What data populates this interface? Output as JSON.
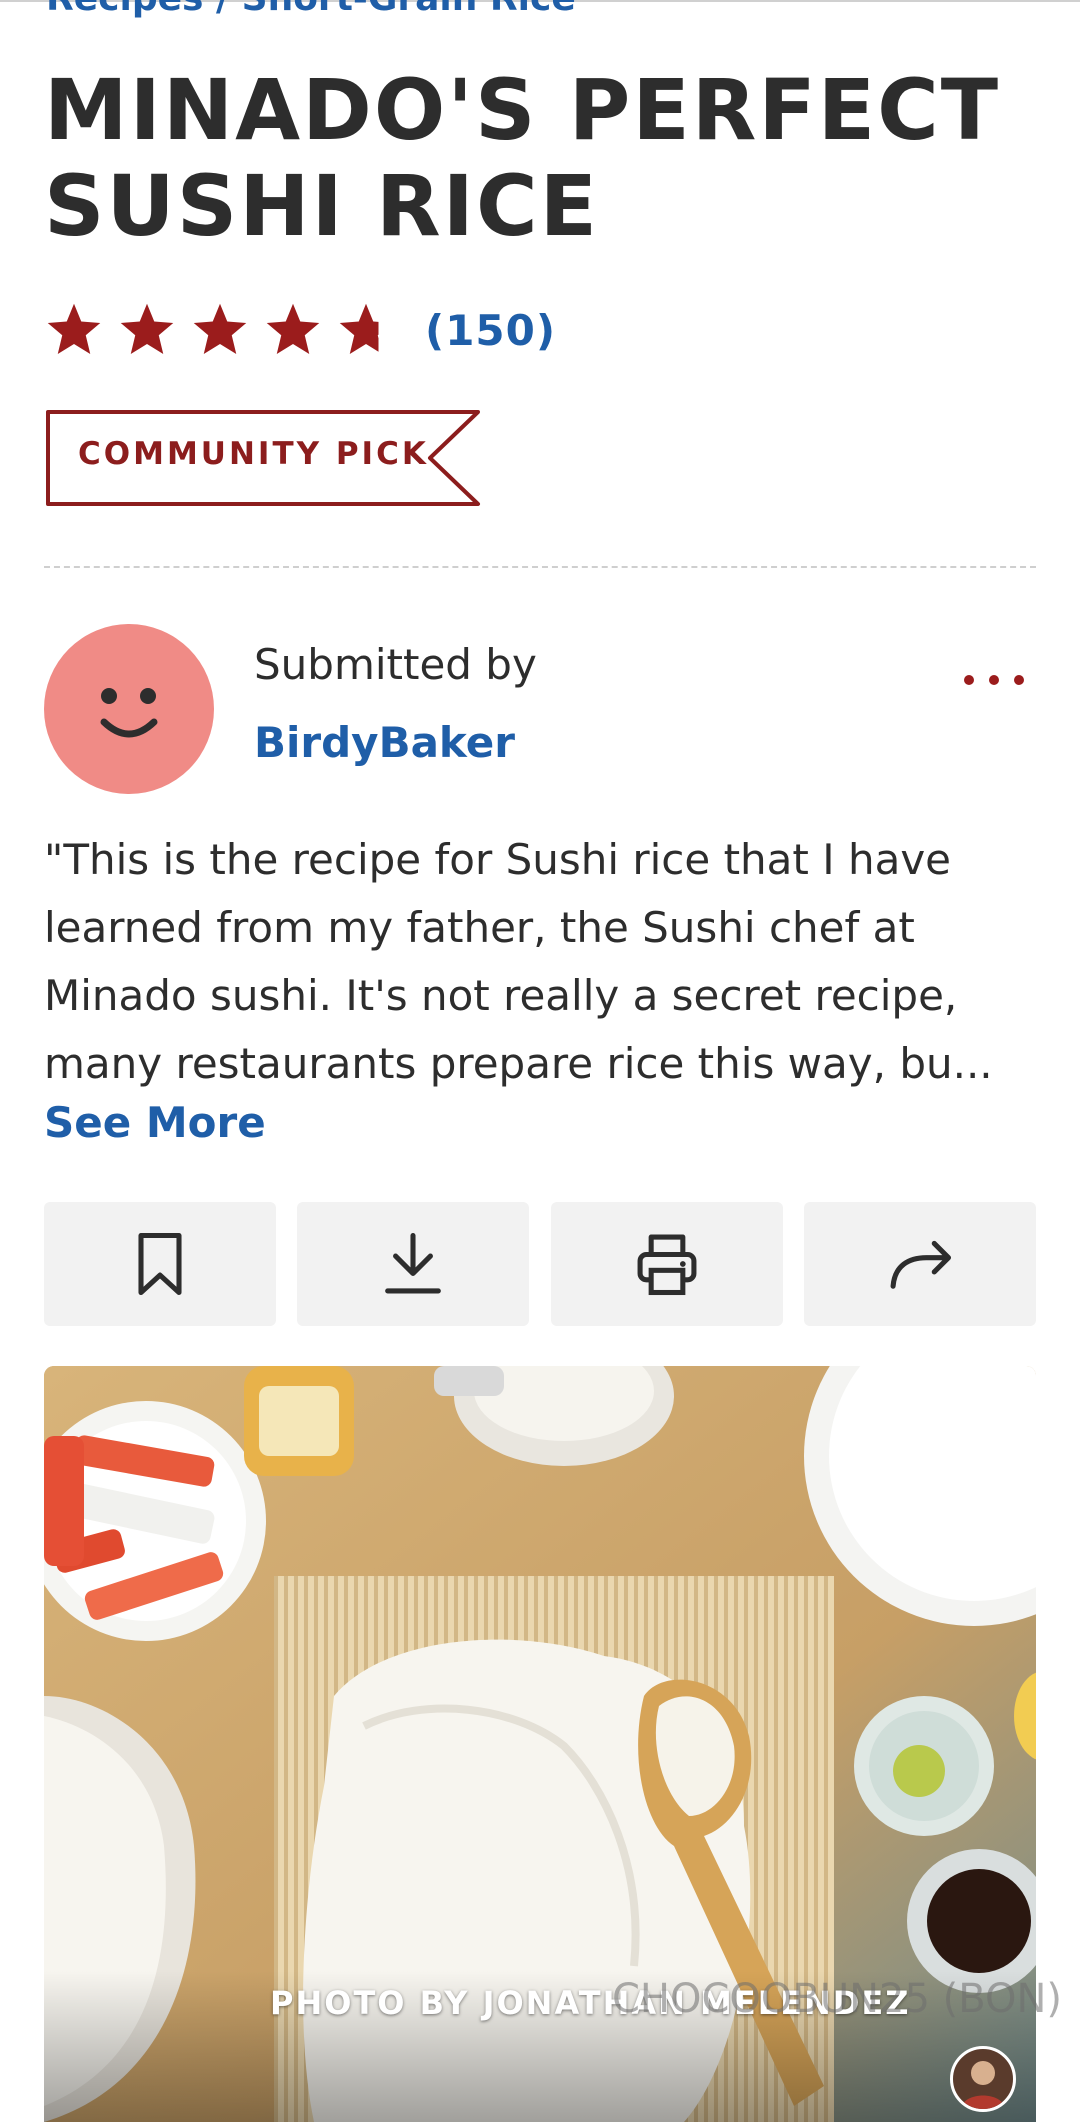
{
  "breadcrumb": "Recipes / Short-Grain Rice",
  "recipe": {
    "title": "MINADO'S PERFECT SUSHI RICE",
    "rating_value": 4.5,
    "rating_count": "(150)",
    "badge": "COMMUNITY PICK"
  },
  "submitter": {
    "label": "Submitted by",
    "name": "BirdyBaker"
  },
  "description": "\"This is the recipe for Sushi rice that I have learned from my father, the Sushi chef at Minado sushi. It's not really a secret recipe, many restaurants prepare rice this way, bu...",
  "see_more": "See More",
  "actions": [
    {
      "icon": "bookmark-icon"
    },
    {
      "icon": "download-icon"
    },
    {
      "icon": "print-icon"
    },
    {
      "icon": "share-icon"
    }
  ],
  "photo": {
    "credit": "PHOTO BY JONATHAN MELENDEZ",
    "watermark": "CHOCOOBUN25 (BON)"
  },
  "colors": {
    "brand_red": "#9b1c1c",
    "link_blue": "#1f5ea8",
    "avatar_pink": "#f08b86",
    "button_bg": "#f2f2f2"
  }
}
